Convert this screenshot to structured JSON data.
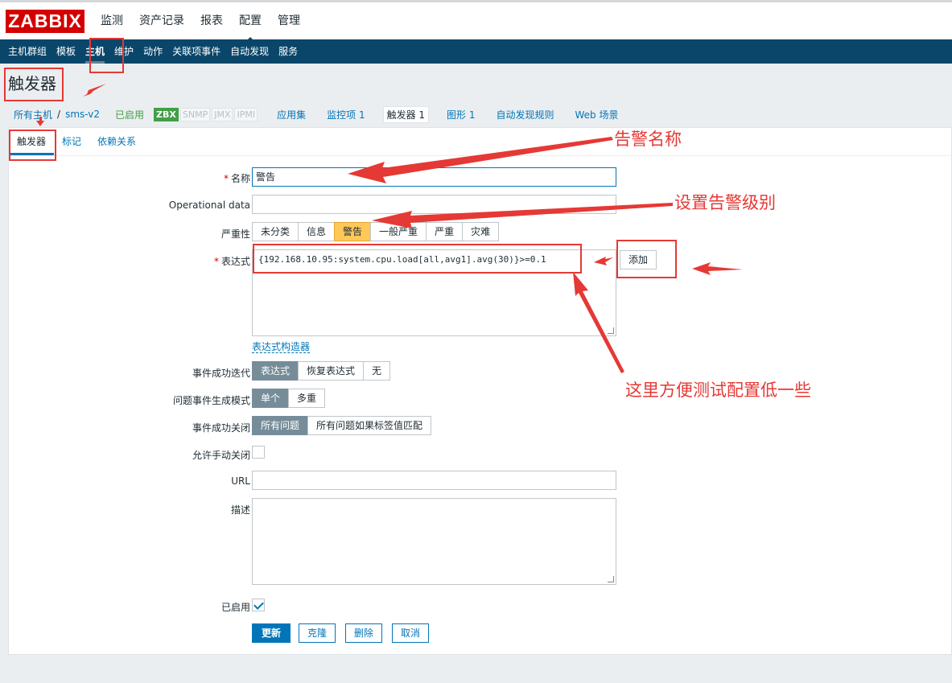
{
  "logo": "ZABBIX",
  "main_menu": [
    "监测",
    "资产记录",
    "报表",
    "配置",
    "管理"
  ],
  "sub_menu": [
    "主机群组",
    "模板",
    "主机",
    "维护",
    "动作",
    "关联项事件",
    "自动发现",
    "服务"
  ],
  "page_title": "触发器",
  "breadcrumb": {
    "all_hosts": "所有主机",
    "separator": "/",
    "host": "sms-v2",
    "status": "已启用",
    "badges": [
      "ZBX",
      "SNMP",
      "JMX",
      "IPMI"
    ],
    "tabs": [
      "应用集",
      "监控项 1",
      "触发器 1",
      "图形 1",
      "自动发现规则",
      "Web 场景"
    ]
  },
  "form_tabs": [
    "触发器",
    "标记",
    "依赖关系"
  ],
  "form": {
    "required_mark": "*",
    "name_label": "名称",
    "name_value": "警告",
    "opdata_label": "Operational data",
    "severity_label": "严重性",
    "severity_options": [
      "未分类",
      "信息",
      "警告",
      "一般严重",
      "严重",
      "灾难"
    ],
    "severity_selected": "警告",
    "expression_label": "表达式",
    "expression_value": "{192.168.10.95:system.cpu.load[all,avg1].avg(30)}>=0.1",
    "add_button": "添加",
    "expression_builder_link": "表达式构造器",
    "ok_event_gen_label": "事件成功迭代",
    "ok_event_gen_options": [
      "表达式",
      "恢复表达式",
      "无"
    ],
    "problem_mode_label": "问题事件生成模式",
    "problem_mode_options": [
      "单个",
      "多重"
    ],
    "ok_close_label": "事件成功关闭",
    "ok_close_options": [
      "所有问题",
      "所有问题如果标签值匹配"
    ],
    "manual_close_label": "允许手动关闭",
    "url_label": "URL",
    "description_label": "描述",
    "enabled_label": "已启用"
  },
  "actions": {
    "update": "更新",
    "clone": "克隆",
    "delete": "删除",
    "cancel": "取消"
  },
  "annotations": {
    "name_note": "告警名称",
    "severity_note": "设置告警级别",
    "expression_note": "这里方便测试配置低一些"
  },
  "colors": {
    "brand_red": "#d40000",
    "nav_blue": "#0a466a",
    "link_blue": "#0275b8",
    "warning_yellow": "#ffc859",
    "annotation_red": "#e53935"
  }
}
